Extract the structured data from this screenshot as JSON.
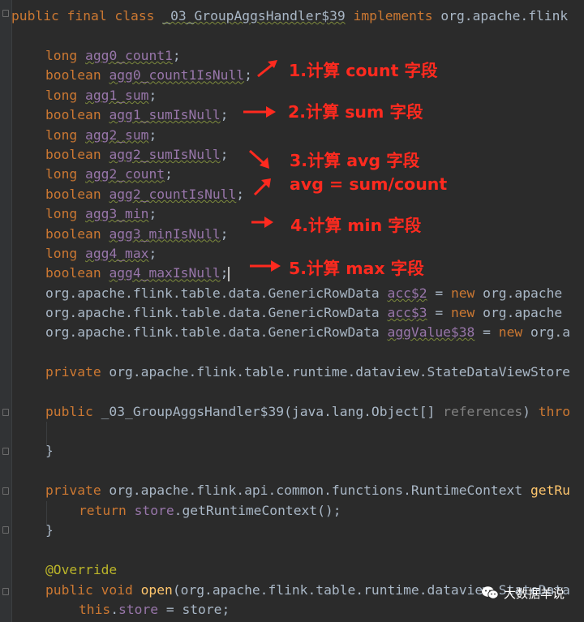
{
  "code": {
    "class_decl": {
      "modifiers": "public final class",
      "class_name": "_03_GroupAggsHandler$39",
      "implements": "implements",
      "iface": "org.apache.flink"
    },
    "fields": [
      {
        "type": "long",
        "name": "agg0_count1",
        "end": ";"
      },
      {
        "type": "boolean",
        "name": "agg0_count1IsNull",
        "end": ";"
      },
      {
        "type": "long",
        "name": "agg1_sum",
        "end": ";"
      },
      {
        "type": "boolean",
        "name": "agg1_sumIsNull",
        "end": ";"
      },
      {
        "type": "long",
        "name": "agg2_sum",
        "end": ";"
      },
      {
        "type": "boolean",
        "name": "agg2_sumIsNull",
        "end": ";"
      },
      {
        "type": "long",
        "name": "agg2_count",
        "end": ";"
      },
      {
        "type": "boolean",
        "name": "agg2_countIsNull",
        "end": ";"
      },
      {
        "type": "long",
        "name": "agg3_min",
        "end": ";"
      },
      {
        "type": "boolean",
        "name": "agg3_minIsNull",
        "end": ";"
      },
      {
        "type": "long",
        "name": "agg4_max",
        "end": ";"
      },
      {
        "type": "boolean",
        "name": "agg4_maxIsNull",
        "end": ";"
      }
    ],
    "rowdata_lines": [
      {
        "type": "org.apache.flink.table.data.GenericRowData",
        "name": "acc$2",
        "eq": " = ",
        "kw_new": "new",
        "rest": " org.apache"
      },
      {
        "type": "org.apache.flink.table.data.GenericRowData",
        "name": "acc$3",
        "eq": " = ",
        "kw_new": "new",
        "rest": " org.apache"
      },
      {
        "type": "org.apache.flink.table.data.GenericRowData",
        "name": "aggValue$38",
        "eq": " = ",
        "kw_new": "new",
        "rest": " org.a"
      }
    ],
    "store_decl": {
      "kw": "private",
      "type": " org.apache.flink.table.runtime.dataview.StateDataViewStore"
    },
    "ctor": {
      "kw": "public",
      "name": " _03_GroupAggsHandler$39",
      "params": "(java.lang.Object[]",
      "param_name": " references",
      "close": ") ",
      "kw_throws": "thro"
    },
    "close_brace": "}",
    "get_ctx": {
      "kw": "private",
      "type": " org.apache.flink.api.common.functions.RuntimeContext ",
      "method": "getRu"
    },
    "return_line": {
      "kw": "return",
      "field": " store",
      "rest": ".getRuntimeContext();"
    },
    "override": "@Override",
    "open_line": {
      "kw": "public void",
      "method": " open",
      "rest": "(org.apache.flink.table.runtime.dataview.StateData"
    },
    "assign_line": {
      "kw": "this",
      "dot": ".",
      "field": "store",
      "rest": " = store;"
    }
  },
  "annotations": [
    "1.计算 count 字段",
    "2.计算 sum 字段",
    "3.计算 avg 字段",
    "avg = sum/count",
    "4.计算 min 字段",
    "5.计算 max 字段"
  ],
  "watermark": {
    "icon": "wechat-icon",
    "text": "大数据羊说"
  },
  "colors": {
    "background": "#2b2b2b",
    "keyword": "#cc7832",
    "field": "#9876aa",
    "method": "#ffc66d",
    "annotation_text": "#ff2a1f"
  }
}
